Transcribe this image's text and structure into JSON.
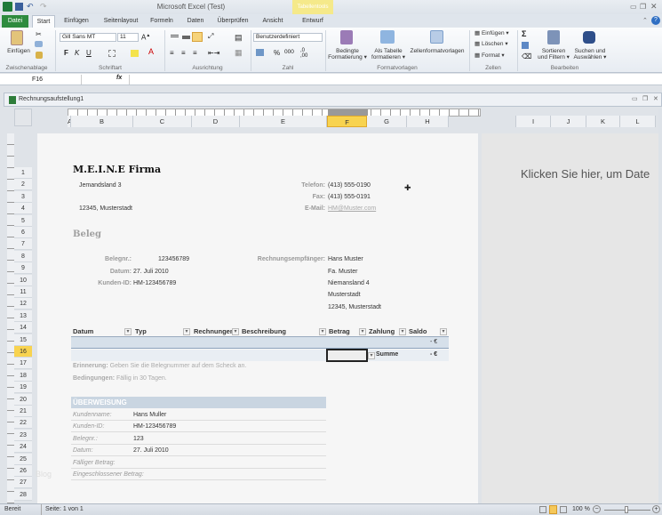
{
  "app": {
    "title": "Microsoft Excel (Test)",
    "context_tab": "Tabellentools"
  },
  "tabs": [
    "Datei",
    "Start",
    "Einfügen",
    "Seitenlayout",
    "Formeln",
    "Daten",
    "Überprüfen",
    "Ansicht",
    "Entwurf"
  ],
  "ribbon": {
    "paste": "Einfügen",
    "font_name": "Gill Sans MT",
    "font_size": "11",
    "bold": "F",
    "italic": "K",
    "underline": "U",
    "number_format": "Benutzerdefiniert",
    "percent": "%",
    "thousands": "000",
    "cond_format": [
      "Bedingte",
      "Formatierung"
    ],
    "as_table": [
      "Als Tabelle",
      "formatieren"
    ],
    "cell_styles": "Zellenformatvorlagen",
    "insert": "Einfügen",
    "delete": "Löschen",
    "format": "Format",
    "sum": "Σ",
    "sort": [
      "Sortieren",
      "und Filtern"
    ],
    "find": [
      "Suchen und",
      "Auswählen"
    ],
    "groups": [
      "Zwischenablage",
      "Schriftart",
      "Ausrichtung",
      "Zahl",
      "Formatvorlagen",
      "Zellen",
      "Bearbeiten"
    ]
  },
  "formula_bar": {
    "name_box": "F16",
    "fx": "fx",
    "value": ""
  },
  "workbook": {
    "title": "Rechnungsaufstellung1"
  },
  "columns": [
    "A",
    "B",
    "C",
    "D",
    "E",
    "F",
    "G",
    "H",
    "I",
    "J",
    "K",
    "L"
  ],
  "selected_column": "F",
  "rows": [
    "1",
    "2",
    "3",
    "4",
    "5",
    "6",
    "7",
    "8",
    "9",
    "10",
    "11",
    "12",
    "13",
    "14",
    "15",
    "16",
    "17",
    "18",
    "19",
    "20",
    "21",
    "22",
    "23",
    "24",
    "25",
    "26",
    "27",
    "28"
  ],
  "selected_row": "16",
  "sheet": {
    "company": "M.E.I.N.E Firma",
    "street": "Jemandsland 3",
    "city": "12345, Musterstadt",
    "phone_label": "Telefon:",
    "phone": "(413) 555-0190",
    "fax_label": "Fax:",
    "fax": "(413) 555-0191",
    "email_label": "E-Mail:",
    "email": "HM@Muster.com",
    "heading": "Beleg",
    "receipt_label": "Belegnr.:",
    "receipt": "123456789",
    "date_label": "Datum:",
    "date": "27. Juli 2010",
    "customer_label": "Kunden-ID:",
    "customer": "HM-123456789",
    "recipient_label": "Rechnungsempfänger:",
    "recipient": [
      "Hans Muster",
      "Fa. Muster",
      "Niemansland 4",
      "Musterstadt",
      "12345, Musterstadt"
    ],
    "table_headers": [
      "Datum",
      "Typ",
      "Rechnungen",
      "Beschreibung",
      "Betrag",
      "Zahlung",
      "Saldo"
    ],
    "row15_saldo": "- €",
    "row16_zahlung": "Summe",
    "row16_saldo": "- €",
    "reminder_label": "Erinnerung:",
    "reminder": "Geben Sie die Belegnummer auf dem Scheck an.",
    "terms_label": "Bedingungen:",
    "terms": "Fällig in 30 Tagen.",
    "transfer_title": "ÜBERWEISUNG",
    "transfer": [
      {
        "label": "Kundenname:",
        "value": "Hans Muller"
      },
      {
        "label": "Kunden-ID:",
        "value": "HM-123456789"
      },
      {
        "label": "Belegnr.:",
        "value": "123"
      },
      {
        "label": "Datum:",
        "value": "27. Juli 2010"
      },
      {
        "label": "Fälliger Betrag:",
        "value": ""
      },
      {
        "label": "Eingeschlossener Betrag:",
        "value": ""
      }
    ],
    "watermark": "Blog"
  },
  "right_pane_hint": "Klicken Sie hier, um Date",
  "status": {
    "ready": "Bereit",
    "page": "Seite: 1 von 1",
    "zoom": "100 %"
  }
}
